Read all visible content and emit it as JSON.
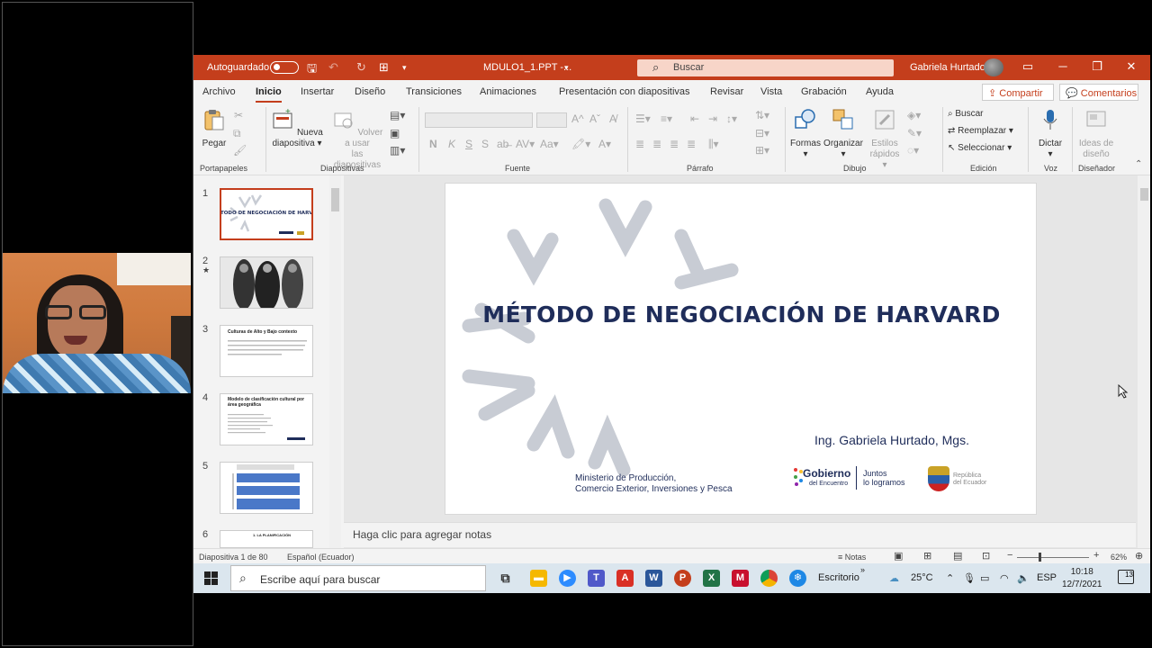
{
  "titlebar": {
    "autosave_label": "Autoguardado",
    "document_name": "MDULO1_1.PPT  -...",
    "search_placeholder": "Buscar",
    "user_name": "Gabriela Hurtado"
  },
  "tabs": [
    {
      "label": "Archivo"
    },
    {
      "label": "Inicio"
    },
    {
      "label": "Insertar"
    },
    {
      "label": "Diseño"
    },
    {
      "label": "Transiciones"
    },
    {
      "label": "Animaciones"
    },
    {
      "label": "Presentación con diapositivas"
    },
    {
      "label": "Revisar"
    },
    {
      "label": "Vista"
    },
    {
      "label": "Grabación"
    },
    {
      "label": "Ayuda"
    }
  ],
  "share_label": "Compartir",
  "comments_label": "Comentarios",
  "ribbon": {
    "paste": "Pegar",
    "new_slide_l1": "Nueva",
    "new_slide_l2": "diapositiva",
    "reuse_l1": "Volver a usar",
    "reuse_l2": "las diapositivas",
    "shapes": "Formas",
    "arrange": "Organizar",
    "styles_l1": "Estilos",
    "styles_l2": "rápidos",
    "find": "Buscar",
    "replace": "Reemplazar",
    "select": "Seleccionar",
    "dictate": "Dictar",
    "ideas_l1": "Ideas de",
    "ideas_l2": "diseño",
    "groups": {
      "clipboard": "Portapapeles",
      "slides": "Diapositivas",
      "font": "Fuente",
      "paragraph": "Párrafo",
      "drawing": "Dibujo",
      "editing": "Edición",
      "voice": "Voz",
      "designer": "Diseñador"
    },
    "font_letters": [
      "N",
      "K",
      "S",
      "S"
    ]
  },
  "thumbnails": [
    {
      "number": "1",
      "title": "MÉTODO DE NEGOCIACIÓN DE HARVARD"
    },
    {
      "number": "2",
      "marker": "★"
    },
    {
      "number": "3",
      "title": "Culturas de Alto y Bajo contexto"
    },
    {
      "number": "4",
      "title": "Modelo de clasificación cultural por área geográfica"
    },
    {
      "number": "5"
    },
    {
      "number": "6",
      "title": "1. LA PLANIFICACIÓN"
    }
  ],
  "slide": {
    "title": "MÉTODO DE NEGOCIACIÓN DE HARVARD",
    "author": "Ing. Gabriela Hurtado, Mgs.",
    "ministry_l1": "Ministerio de Producción,",
    "ministry_l2": "Comercio Exterior, Inversiones y Pesca",
    "gob_l1": "Gobierno",
    "gob_l2": "del Encuentro",
    "gob_l3": "Juntos",
    "gob_l4": "lo logramos",
    "rep_l1": "República",
    "rep_l2": "del Ecuador"
  },
  "notes_placeholder": "Haga clic para agregar notas",
  "status": {
    "slide_info": "Diapositiva 1 de 80",
    "language": "Español (Ecuador)",
    "notes_label": "Notas",
    "zoom": "62%"
  },
  "taskbar": {
    "search_placeholder": "Escribe aquí para buscar",
    "desktop_label": "Escritorio",
    "temperature": "25°C",
    "lang": "ESP",
    "time": "10:18",
    "date": "12/7/2021",
    "notifications": "13"
  },
  "colors": {
    "accent": "#c43e1c",
    "slide_title": "#1f2d5a"
  }
}
